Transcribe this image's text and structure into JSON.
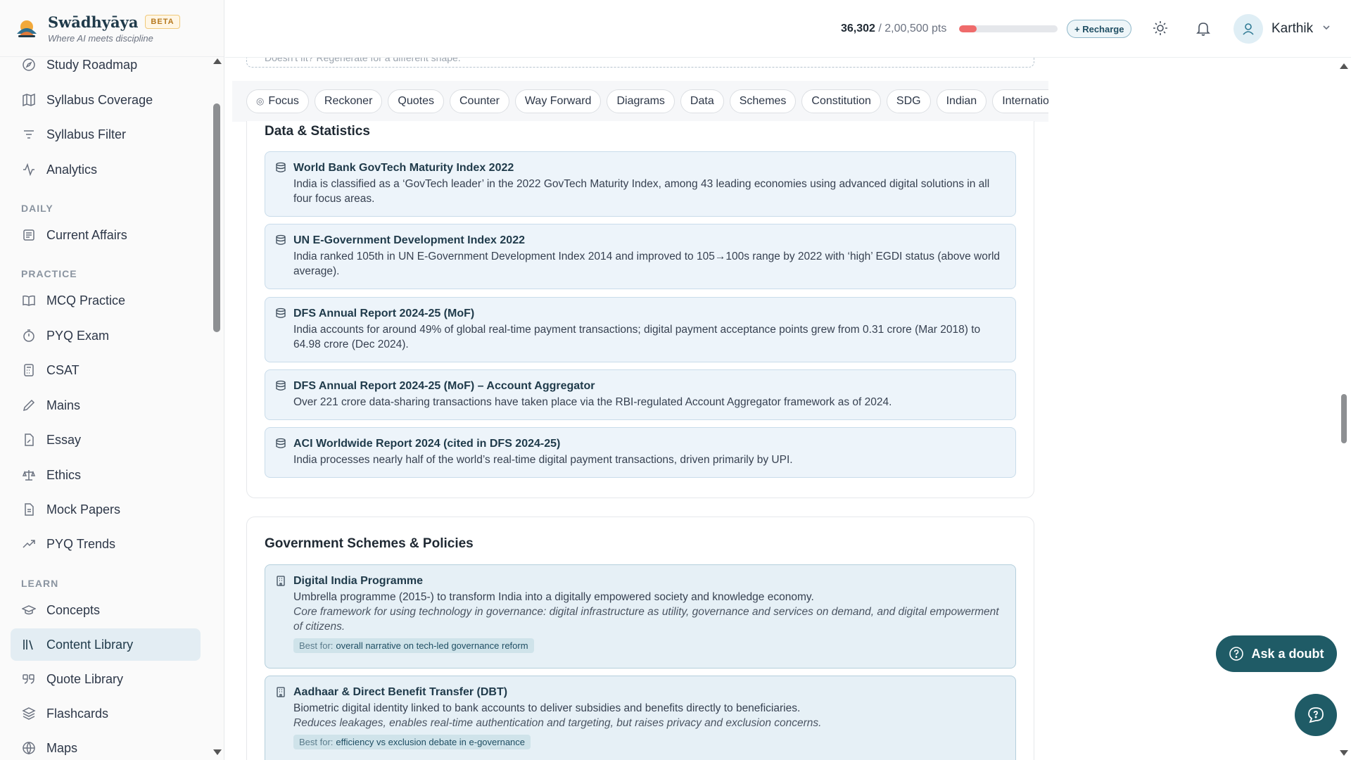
{
  "brand": {
    "name": "Swādhyāya",
    "badge": "BETA",
    "tagline": "Where AI meets discipline"
  },
  "header": {
    "points_current": "36,302",
    "points_total": "/ 2,00,500 pts",
    "progress_fraction": 0.18,
    "recharge_label": "+ Recharge",
    "user_name": "Karthik"
  },
  "sidebar": {
    "items_top": [
      {
        "label": "Study Roadmap",
        "icon": "compass-icon"
      },
      {
        "label": "Syllabus Coverage",
        "icon": "map-icon"
      },
      {
        "label": "Syllabus Filter",
        "icon": "filter-icon"
      },
      {
        "label": "Analytics",
        "icon": "activity-icon"
      }
    ],
    "section_daily": "DAILY",
    "items_daily": [
      {
        "label": "Current Affairs",
        "icon": "newspaper-icon"
      }
    ],
    "section_practice": "PRACTICE",
    "items_practice": [
      {
        "label": "MCQ Practice",
        "icon": "book-open-icon"
      },
      {
        "label": "PYQ Exam",
        "icon": "timer-icon"
      },
      {
        "label": "CSAT",
        "icon": "calculator-icon"
      },
      {
        "label": "Mains",
        "icon": "pen-icon"
      },
      {
        "label": "Essay",
        "icon": "file-pen-icon"
      },
      {
        "label": "Ethics",
        "icon": "scale-icon"
      },
      {
        "label": "Mock Papers",
        "icon": "file-text-icon"
      },
      {
        "label": "PYQ Trends",
        "icon": "trending-up-icon"
      }
    ],
    "section_learn": "LEARN",
    "items_learn": [
      {
        "label": "Concepts",
        "icon": "graduation-cap-icon"
      },
      {
        "label": "Content Library",
        "icon": "library-icon",
        "active": true
      },
      {
        "label": "Quote Library",
        "icon": "quote-icon"
      },
      {
        "label": "Flashcards",
        "icon": "layers-icon"
      },
      {
        "label": "Maps",
        "icon": "globe-icon"
      }
    ]
  },
  "main": {
    "hint_text": "Doesn't fit? Regenerate for a different shape.",
    "tabs": [
      "Focus",
      "Reckoner",
      "Quotes",
      "Counter",
      "Way Forward",
      "Diagrams",
      "Data",
      "Schemes",
      "Constitution",
      "SDG",
      "Indian",
      "International"
    ],
    "data_section": {
      "title": "Data & Statistics",
      "items": [
        {
          "title": "World Bank GovTech Maturity Index 2022",
          "text": "India is classified as a ‘GovTech leader’ in the 2022 GovTech Maturity Index, among 43 leading economies using advanced digital solutions in all four focus areas."
        },
        {
          "title": "UN E-Government Development Index 2022",
          "text": "India ranked 105th in UN E-Government Development Index 2014 and improved to 105→100s range by 2022 with ‘high’ EGDI status (above world average)."
        },
        {
          "title": "DFS Annual Report 2024-25 (MoF)",
          "text": "India accounts for around 49% of global real-time payment transactions; digital payment acceptance points grew from 0.31 crore (Mar 2018) to 64.98 crore (Dec 2024)."
        },
        {
          "title": "DFS Annual Report 2024-25 (MoF) – Account Aggregator",
          "text": "Over 221 crore data-sharing transactions have taken place via the RBI-regulated Account Aggregator framework as of 2024."
        },
        {
          "title": "ACI Worldwide Report 2024 (cited in DFS 2024-25)",
          "text": "India processes nearly half of the world’s real-time digital payment transactions, driven primarily by UPI."
        }
      ]
    },
    "schemes_section": {
      "title": "Government Schemes & Policies",
      "best_for_label": "Best for:",
      "items": [
        {
          "title": "Digital India Programme",
          "text": "Umbrella programme (2015-) to transform India into a digitally empowered society and knowledge economy.",
          "note": "Core framework for using technology in governance: digital infrastructure as utility, governance and services on demand, and digital empowerment of citizens.",
          "best_for": "overall narrative on tech-led governance reform"
        },
        {
          "title": "Aadhaar & Direct Benefit Transfer (DBT)",
          "text": "Biometric digital identity linked to bank accounts to deliver subsidies and benefits directly to beneficiaries.",
          "note": "Reduces leakages, enables real-time authentication and targeting, but raises privacy and exclusion concerns.",
          "best_for": "efficiency vs exclusion debate in e-governance"
        }
      ]
    }
  },
  "floating": {
    "ask_label": "Ask a doubt"
  },
  "colors": {
    "accent": "#1f5b66",
    "progress": "#ef6b6b",
    "active_nav": "#e3edf3"
  }
}
